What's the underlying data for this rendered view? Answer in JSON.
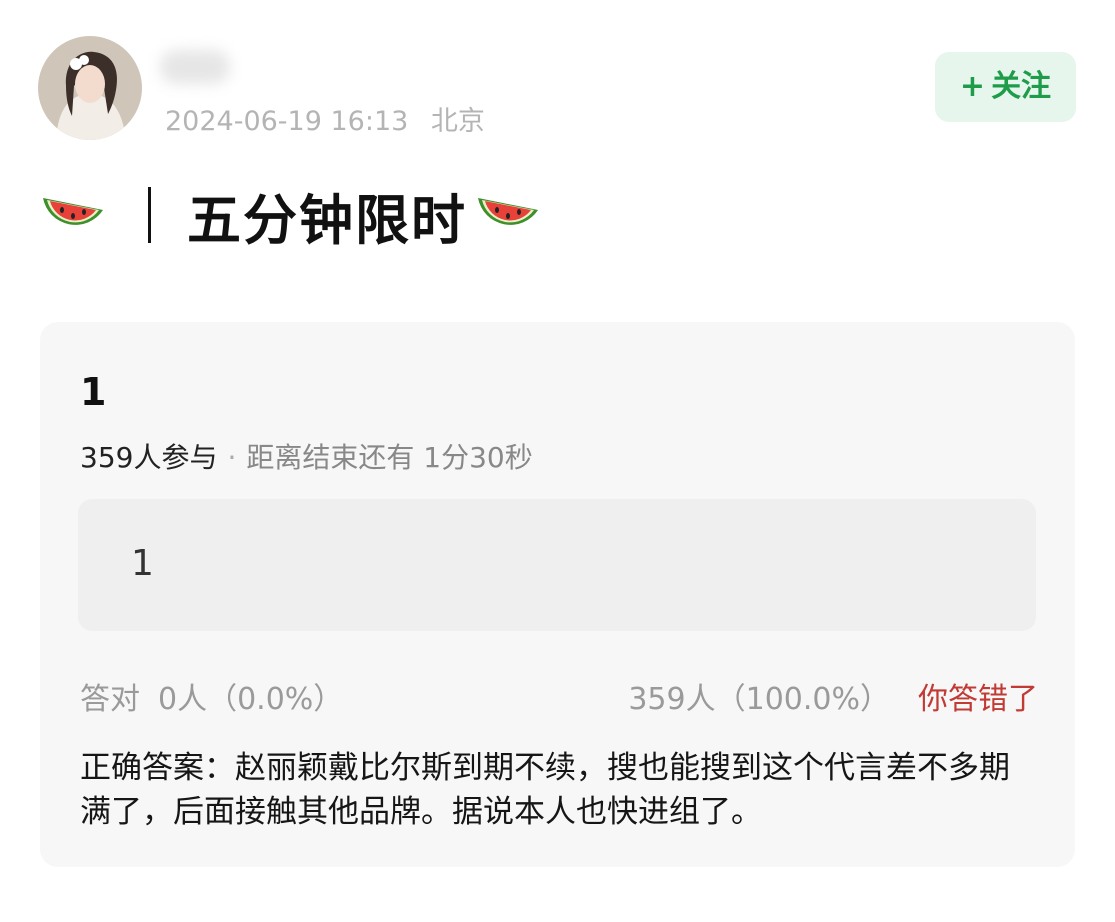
{
  "post": {
    "timestamp": "2024-06-19 16:13",
    "location": "北京",
    "follow_button": {
      "plus": "+",
      "label": "关注"
    },
    "title": "五分钟限时",
    "icons": [
      "watermelon-icon",
      "watermelon-icon"
    ]
  },
  "quiz": {
    "question": "1",
    "participants": "359人参与",
    "separator": "·",
    "remaining": "距离结束还有 1分30秒",
    "option": {
      "label": "1"
    },
    "correct_label": "答对",
    "correct_stats": "0人（0.0%）",
    "selected_stats": "359人（100.0%）",
    "result": "你答错了",
    "answer": "正确答案：赵丽颖戴比尔斯到期不续，搜也能搜到这个代言差不多期满了，后面接触其他品牌。据说本人也快进组了。"
  },
  "colors": {
    "follow_bg": "#e6f6ec",
    "follow_text": "#1e9c4a",
    "wrong_text": "#c23a34",
    "card_bg": "#f7f7f7",
    "option_bg": "#efefef"
  }
}
